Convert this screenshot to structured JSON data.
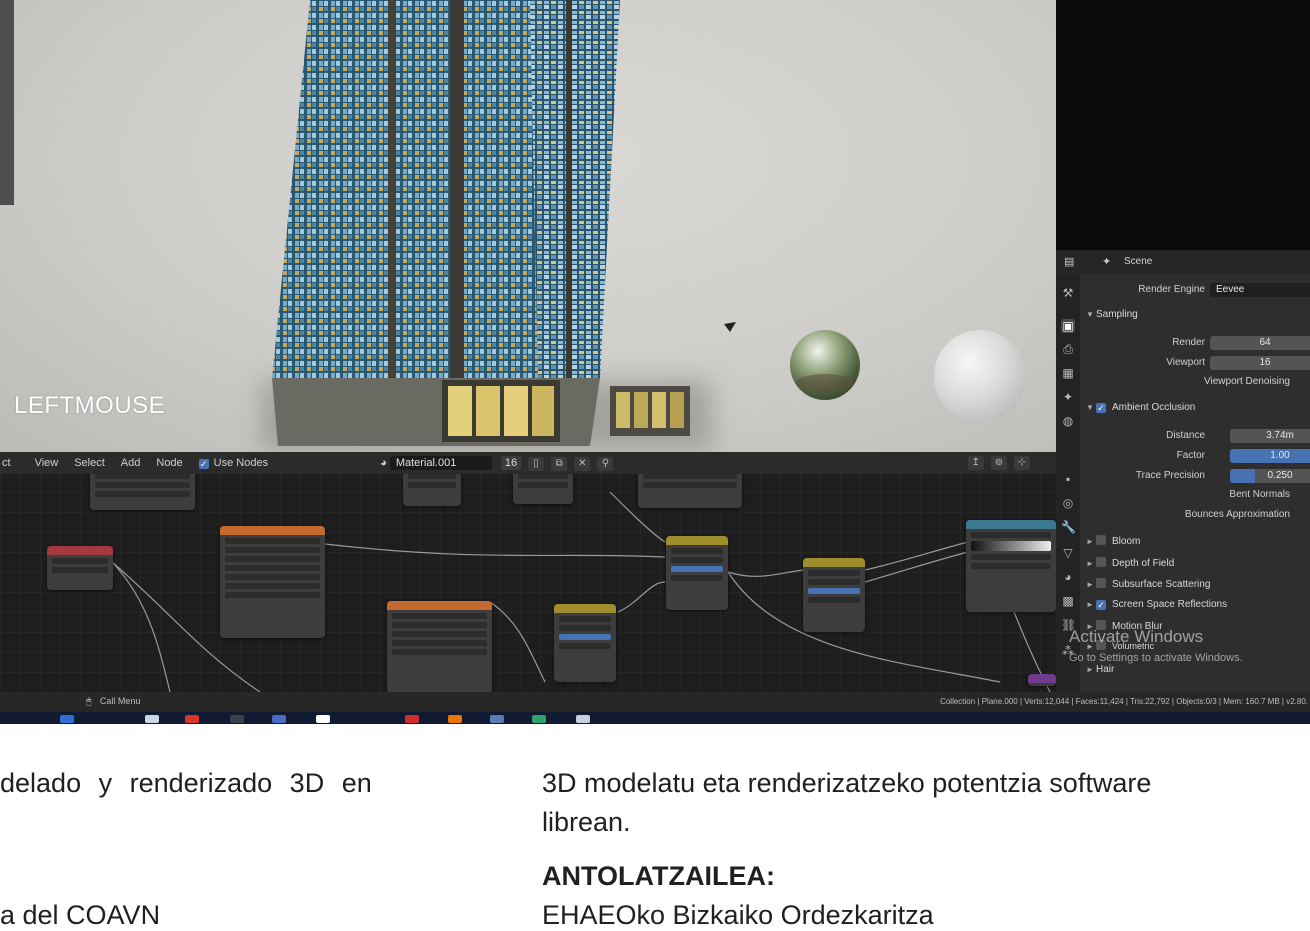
{
  "viewport": {
    "overlay_text": "LEFTMOUSE"
  },
  "node_editor": {
    "menu": [
      "ct",
      "View",
      "Select",
      "Add",
      "Node"
    ],
    "use_nodes_label": "Use Nodes",
    "material_name": "Material.001",
    "users_count": "16"
  },
  "properties": {
    "scene_label": "Scene",
    "render_engine": {
      "label": "Render Engine",
      "value": "Eevee"
    },
    "sampling": {
      "label": "Sampling",
      "render": {
        "label": "Render",
        "value": "64"
      },
      "viewport": {
        "label": "Viewport",
        "value": "16"
      },
      "viewport_denoising": "Viewport Denoising"
    },
    "ambient_occlusion": {
      "label": "Ambient Occlusion",
      "enabled": true,
      "distance": {
        "label": "Distance",
        "value": "3.74m"
      },
      "factor": {
        "label": "Factor",
        "value": "1.00"
      },
      "trace_precision": {
        "label": "Trace Precision",
        "value": "0.250"
      },
      "bent_normals": "Bent Normals",
      "bounces_approximation": "Bounces Approximation"
    },
    "panels": [
      {
        "label": "Bloom",
        "checked": false
      },
      {
        "label": "Depth of Field",
        "checked": false
      },
      {
        "label": "Subsurface Scattering",
        "checked": false
      },
      {
        "label": "Screen Space Reflections",
        "checked": true
      },
      {
        "label": "Motion Blur",
        "checked": false
      },
      {
        "label": "Volumetric",
        "checked": false
      },
      {
        "label": "Hair",
        "checked": false
      }
    ],
    "activate_windows": {
      "title": "Activate Windows",
      "subtitle": "Go to Settings to activate Windows."
    }
  },
  "status_bar": {
    "call_menu": "Call Menu",
    "stats": "Collection | Plane.000 | Verts:12,044 | Faces:11,424 | Tris:22,792 | Objects:0/3 | Mem: 160.7 MB | v2.80."
  },
  "document": {
    "left_line1": "delado y renderizado 3D en",
    "left_line2": "a del COAVN",
    "right_line1": "3D modelatu eta renderizatzeko potentzia software",
    "right_line2": "librean.",
    "right_heading": "ANTOLATZAILEA:",
    "right_line3": "EHAEOko Bizkaiko Ordezkaritza"
  }
}
